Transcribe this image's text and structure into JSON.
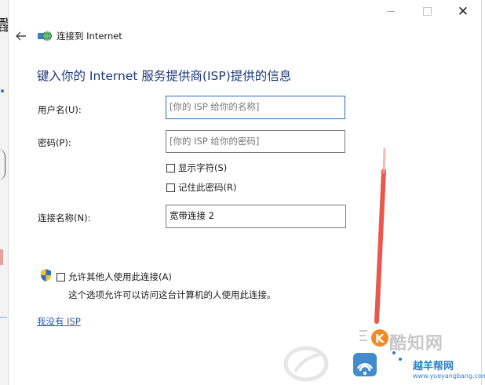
{
  "background": {
    "glyph": "酯"
  },
  "window": {
    "title": "连接到 Internet",
    "close_glyph": "✕"
  },
  "form": {
    "heading": "键入你的 Internet 服务提供商(ISP)提供的信息",
    "username": {
      "label": "用户名(U):",
      "placeholder": "[你的 ISP 给你的名称]"
    },
    "password": {
      "label": "密码(P):",
      "placeholder": "[你的 ISP 给你的密码]"
    },
    "show_chars_label": "显示字符(S)",
    "remember_password_label": "记住此密码(R)",
    "connection_name": {
      "label": "连接名称(N):",
      "value": "宽带连接 2"
    },
    "allow_others_label": "允许其他人使用此连接(A)",
    "allow_others_note": "这个选项允许可以访问这台计算机的人使用此连接。",
    "no_isp_link": "我没有 ISP"
  },
  "icons": {
    "back": "back-arrow-icon",
    "network": "network-globe-icon",
    "shield": "uac-shield-icon"
  },
  "colors": {
    "heading": "#1e3a78",
    "link": "#2a5db0",
    "annotation_arrow": "#e63a2e",
    "watermark_orange": "#f08a24",
    "watermark_blue": "#2f7fc7"
  },
  "watermark": {
    "title": "酷知网",
    "yue": "越羊帮网",
    "url": "www.yueyangbang.com"
  }
}
